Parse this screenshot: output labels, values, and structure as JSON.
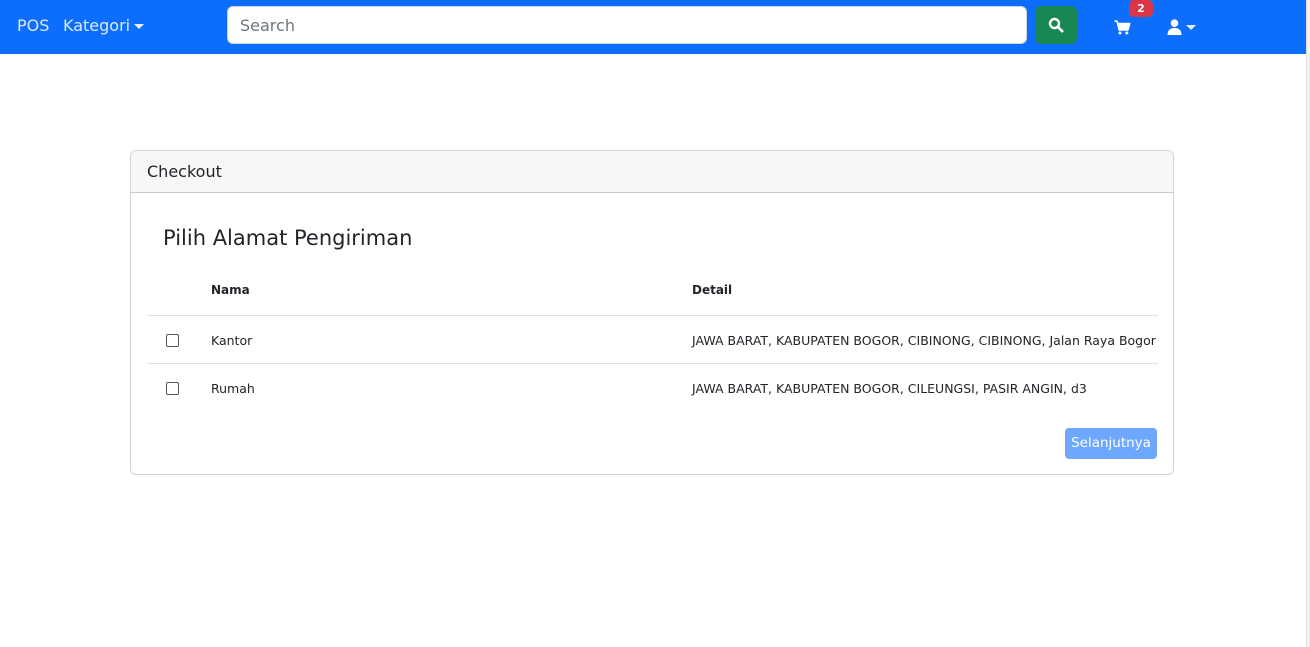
{
  "navbar": {
    "brand": "POS",
    "category_label": "Kategori",
    "search_placeholder": "Search",
    "cart_count": "2",
    "accent_color": "#0d6efd",
    "search_button_color": "#198754",
    "badge_color": "#dc3545",
    "icons": [
      "search-icon",
      "cart-icon",
      "user-icon",
      "chevron-down-icon"
    ]
  },
  "checkout": {
    "header": "Checkout",
    "title": "Pilih Alamat Pengiriman",
    "columns": {
      "name": "Nama",
      "detail": "Detail"
    },
    "addresses": [
      {
        "name": "Kantor",
        "detail": "JAWA BARAT, KABUPATEN BOGOR, CIBINONG, CIBINONG, Jalan Raya Bogor",
        "checked": false
      },
      {
        "name": "Rumah",
        "detail": "JAWA BARAT, KABUPATEN BOGOR, CILEUNGSI, PASIR ANGIN, d3",
        "checked": false
      }
    ],
    "next_label": "Selanjutnya"
  }
}
